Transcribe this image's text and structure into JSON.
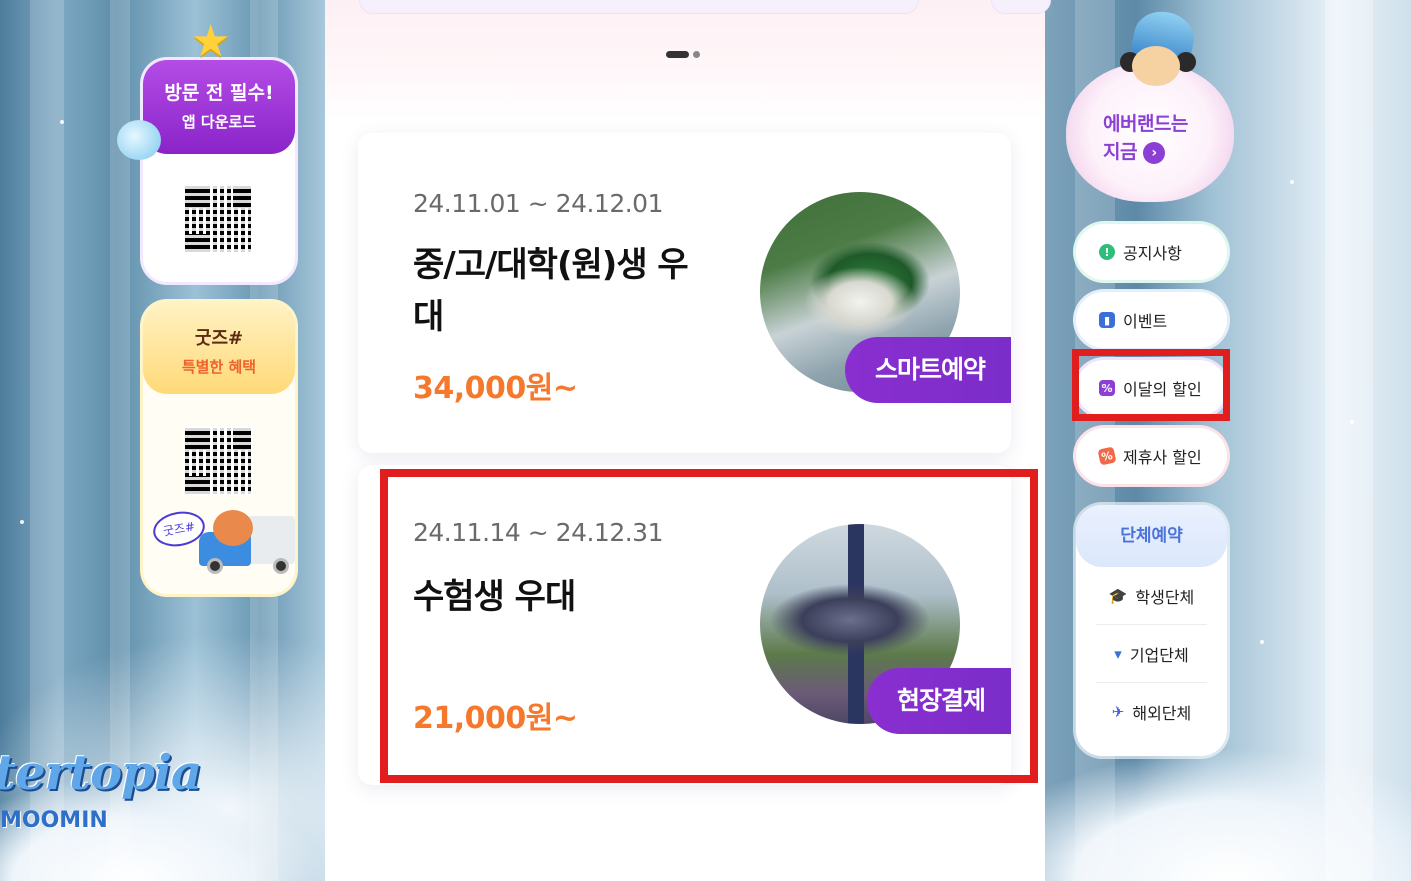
{
  "left_panel": {
    "app_card": {
      "title": "방문 전 필수!",
      "subtitle": "앱 다운로드"
    },
    "goods_card": {
      "title": "굿즈#",
      "subtitle": "특별한 혜택",
      "bubble": "굿즈#"
    },
    "logo": {
      "text": "tertopia",
      "sub": "MOOMIN"
    }
  },
  "center": {
    "carousel": {
      "page": 1,
      "total": 2
    },
    "offers": [
      {
        "date_range": "24.11.01 ~ 24.12.01",
        "title": "중/고/대학(원)생 우대",
        "price": "34,000원~",
        "tag": "스마트예약"
      },
      {
        "date_range": "24.11.14 ~ 24.12.31",
        "title": "수험생 우대",
        "price": "21,000원~",
        "tag": "현장결제"
      }
    ]
  },
  "right_panel": {
    "mascot_text_line1": "에버랜드는",
    "mascot_text_line2": "지금",
    "menu": [
      {
        "label": "공지사항",
        "icon": "notice-icon",
        "icon_color": "#2ebd7a"
      },
      {
        "label": "이벤트",
        "icon": "gift-icon",
        "icon_color": "#3a6fd8"
      },
      {
        "label": "이달의 할인",
        "icon": "coupon-icon",
        "icon_color": "#8b3fd4"
      },
      {
        "label": "제휴사 할인",
        "icon": "ticket-icon",
        "icon_color": "#f06a4a"
      }
    ],
    "group": {
      "title": "단체예약",
      "items": [
        {
          "label": "학생단체",
          "icon": "graduation-cap-icon"
        },
        {
          "label": "기업단체",
          "icon": "tie-icon"
        },
        {
          "label": "해외단체",
          "icon": "airplane-icon"
        }
      ]
    }
  },
  "colors": {
    "accent_purple": "#8a2ed0",
    "price_orange": "#f5782c",
    "highlight_red": "#e11d1d"
  }
}
